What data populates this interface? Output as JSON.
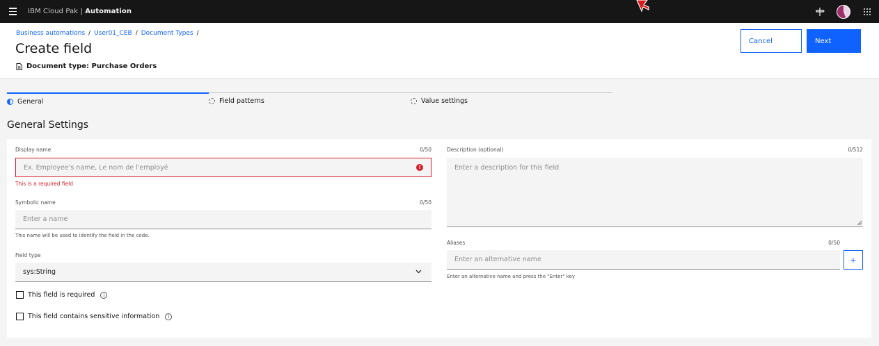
{
  "topbar": {
    "brand_prefix": "IBM Cloud Pak | ",
    "brand_product": "Automation"
  },
  "header": {
    "breadcrumbs": [
      "Business automations",
      "User01_CEB",
      "Document Types"
    ],
    "title": "Create field",
    "doc_type": "Document type: Purchase Orders",
    "cancel_label": "Cancel",
    "next_label": "Next"
  },
  "progress": {
    "steps": [
      "General",
      "Field patterns",
      "Value settings"
    ]
  },
  "section_title": "General Settings",
  "form": {
    "display_name": {
      "label": "Display name",
      "counter": "0/50",
      "placeholder": "Ex. Employee's name, Le nom de l'employé",
      "error": "This is a required field"
    },
    "symbolic_name": {
      "label": "Symbolic name",
      "counter": "0/50",
      "placeholder": "Enter a name",
      "helper": "This name will be used to identify the field in the code."
    },
    "field_type": {
      "label": "Field type",
      "value": "sys:String"
    },
    "required_checkbox": "This field is required",
    "sensitive_checkbox": "This field contains sensitive information",
    "description": {
      "label": "Description (optional)",
      "counter": "0/512",
      "placeholder": "Enter a description for this field"
    },
    "aliases": {
      "label": "Aliases",
      "counter": "0/50",
      "placeholder": "Enter an alternative name",
      "helper": "Enter an alternative name and press the \"Enter\" key",
      "add_label": "+"
    }
  },
  "colors": {
    "primary": "#0f62fe",
    "error": "#da1e28",
    "topbar": "#161616"
  }
}
